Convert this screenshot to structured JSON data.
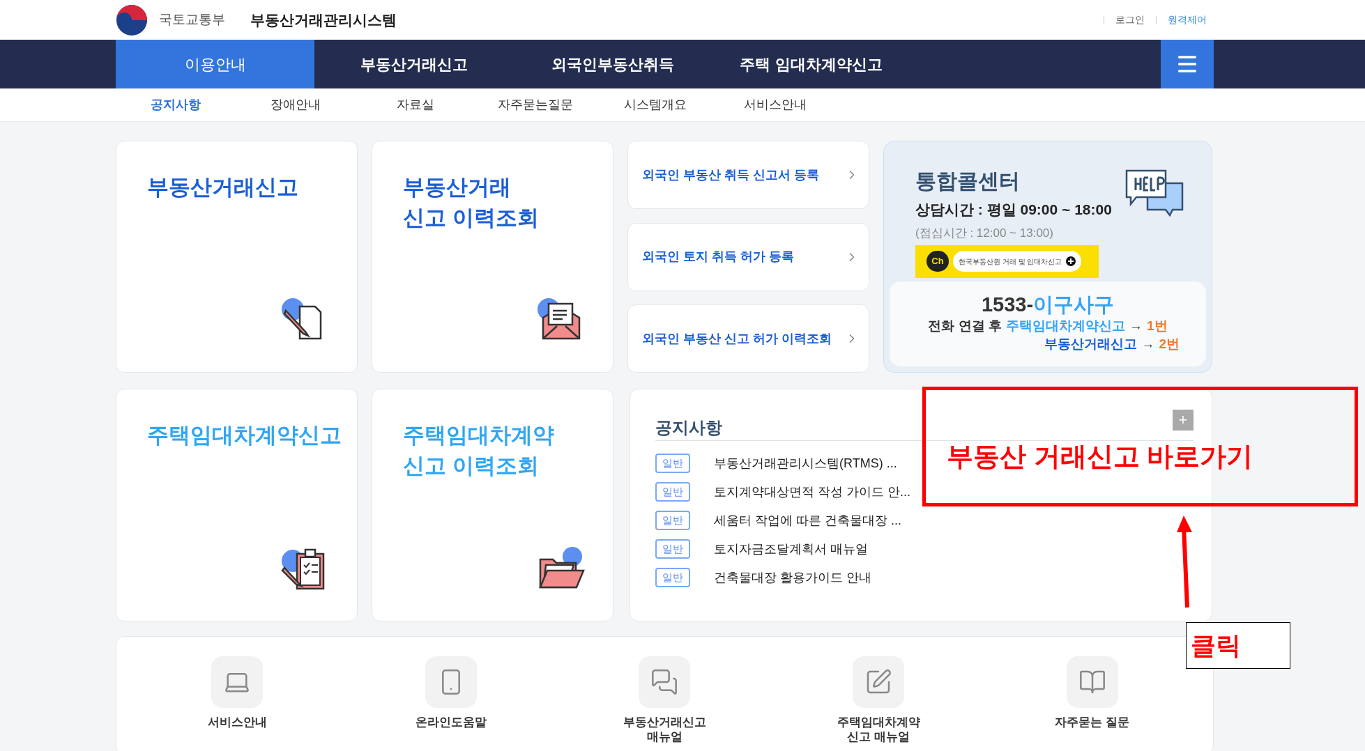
{
  "header": {
    "ministry": "국토교통부",
    "system": "부동산거래관리시스템",
    "links": [
      "로그인",
      "원격제어"
    ]
  },
  "nav": {
    "tabs": [
      {
        "label": "이용안내",
        "selected": true
      },
      {
        "label": "부동산거래신고",
        "selected": false
      },
      {
        "label": "외국인부동산취득",
        "selected": false
      },
      {
        "label": "주택 임대차계약신고",
        "selected": false
      }
    ]
  },
  "subnav": [
    {
      "label": "공지사항",
      "selected": true
    },
    {
      "label": "장애안내",
      "selected": false
    },
    {
      "label": "자료실",
      "selected": false
    },
    {
      "label": "자주묻는질문",
      "selected": false
    },
    {
      "label": "시스템개요",
      "selected": false
    },
    {
      "label": "서비스안내",
      "selected": false
    }
  ],
  "cards": [
    {
      "lines": [
        "부동산거래신고"
      ],
      "color": "#1a5fd6",
      "kind": "document"
    },
    {
      "lines": [
        "부동산거래",
        "신고 이력조회"
      ],
      "color": "#1a5fd6",
      "kind": "envelope"
    },
    {
      "lines": [
        "주택임대차계약신고"
      ],
      "color": "#2fa6f2",
      "kind": "clipboard"
    },
    {
      "lines": [
        "주택임대차계약",
        "신고 이력조회"
      ],
      "color": "#2fa6f2",
      "kind": "folder"
    }
  ],
  "foreign_links": [
    "외국인 부동산 취득 신고서 등록",
    "외국인 토지 취득 허가 등록",
    "외국인 부동산 신고 허가 이력조회"
  ],
  "call_center": {
    "title": "통합콜센터",
    "hours": "상담시간 : 평일 09:00 ~ 18:00",
    "lunch": "(점심시간 : 12:00 ~ 13:00)",
    "kakao": {
      "badge": "Ch",
      "label": "한국부동산원 거래 및 임대차신고"
    },
    "phone_number": "1533-",
    "phone_word": "이구사구",
    "lines": [
      [
        {
          "text": "전화 연결 후",
          "kind": "plain"
        },
        {
          "text": "주택임대차계약신고",
          "kind": "light"
        },
        {
          "text": "→",
          "kind": "plain"
        },
        {
          "text": "1번",
          "kind": "number"
        }
      ],
      [
        {
          "text": "부동산거래신고",
          "kind": "dark"
        },
        {
          "text": "→",
          "kind": "plain"
        },
        {
          "text": "2번",
          "kind": "number"
        }
      ]
    ]
  },
  "notices": {
    "title": "공지사항",
    "more": "+",
    "items": [
      {
        "badge": "일반",
        "title": "부동산거래관리시스템(RTMS) ..."
      },
      {
        "badge": "일반",
        "title": "토지계약대상면적 작성 가이드 안..."
      },
      {
        "badge": "일반",
        "title": "세움터 작업에 따른 건축물대장 ..."
      },
      {
        "badge": "일반",
        "title": "토지자금조달계획서 매뉴얼"
      },
      {
        "badge": "일반",
        "title": "건축물대장 활용가이드 안내"
      }
    ]
  },
  "quick_links": [
    {
      "lines": [
        "서비스안내"
      ],
      "kind": "laptop"
    },
    {
      "lines": [
        "온라인도움말"
      ],
      "kind": "phone"
    },
    {
      "lines": [
        "부동산거래신고",
        "매뉴얼"
      ],
      "kind": "chat"
    },
    {
      "lines": [
        "주택임대차계약",
        "신고 매뉴얼"
      ],
      "kind": "pen"
    },
    {
      "lines": [
        "자주묻는 질문"
      ],
      "kind": "book"
    }
  ],
  "annotation": {
    "callout": "부동산 거래신고 바로가기",
    "note": "클릭"
  }
}
